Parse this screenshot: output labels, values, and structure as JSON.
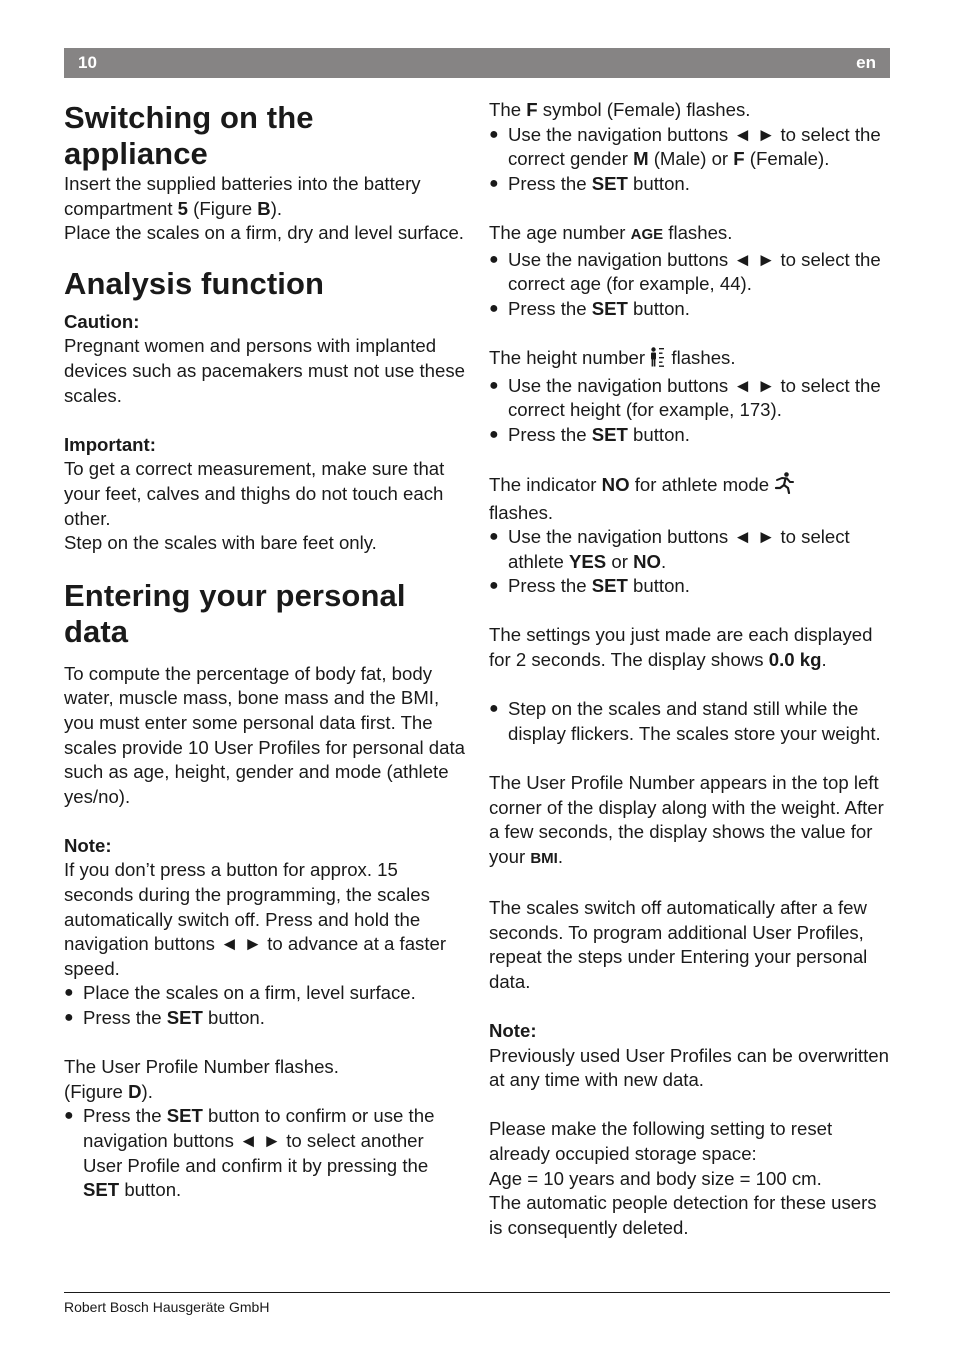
{
  "header": {
    "page_number": "10",
    "language": "en"
  },
  "footer": {
    "company": "Robert Bosch Hausgeräte GmbH"
  },
  "left_column": {
    "switching": {
      "title": "Switching on the appliance",
      "paragraphs": [
        [
          {
            "t": "Insert the supplied batteries into the battery compartment "
          },
          {
            "t": "5",
            "b": true
          },
          {
            "t": " (Figure "
          },
          {
            "t": "B",
            "b": true
          },
          {
            "t": ")."
          }
        ],
        [
          {
            "t": "Place the scales on a firm, dry and level surface."
          }
        ]
      ]
    },
    "analysis": {
      "title": "Analysis function",
      "caution_label": "Caution:",
      "caution_text": "Pregnant women and persons with implanted devices such as pacemakers must not use these scales.",
      "important_label": "Important:",
      "important_text": "To get a correct measurement, make sure that your feet, calves and thighs do not touch each other.",
      "important_text2": "Step on the scales with bare feet only."
    },
    "entering": {
      "title": "Entering your personal data",
      "intro": "To compute the percentage of body fat, body water, muscle mass, bone mass and the BMI, you must enter some personal data first. The scales provide 10 User Profiles for personal data such as age, height, gender and mode (athlete yes/no).",
      "note_label": "Note:",
      "note_text": "If you don’t press a button for approx. 15 seconds during the programming, the scales automatically switch off. Press and hold the navigation buttons ◄ ► to advance at a faster speed.",
      "bullets1": [
        [
          {
            "t": "Place the scales on a firm, level surface."
          }
        ],
        [
          {
            "t": "Press the "
          },
          {
            "t": "SET",
            "b": true
          },
          {
            "t": " button."
          }
        ]
      ],
      "profile_flashes": "The User Profile Number flashes.",
      "figure_ref": [
        {
          "t": "(Figure "
        },
        {
          "t": "D",
          "b": true
        },
        {
          "t": ")."
        }
      ],
      "bullets2": [
        [
          {
            "t": "Press the "
          },
          {
            "t": "SET",
            "b": true
          },
          {
            "t": " button to confirm or use the navigation buttons ◄ ► to select another User Profile and confirm it by pressing the "
          },
          {
            "t": "SET",
            "b": true
          },
          {
            "t": " button."
          }
        ]
      ]
    }
  },
  "right_column": {
    "gender": {
      "intro": [
        {
          "t": "The "
        },
        {
          "t": "F",
          "b": true
        },
        {
          "t": " symbol (Female)  flashes."
        }
      ],
      "bullets": [
        [
          {
            "t": "Use the navigation buttons ◄ ► to select the correct gender "
          },
          {
            "t": "M",
            "b": true
          },
          {
            "t": " (Male) or "
          },
          {
            "t": "F",
            "b": true
          },
          {
            "t": " (Female)."
          }
        ],
        [
          {
            "t": "Press the "
          },
          {
            "t": "SET",
            "b": true
          },
          {
            "t": " button."
          }
        ]
      ]
    },
    "age": {
      "intro": [
        {
          "t": "The age number "
        },
        {
          "t": "AGE",
          "b": true,
          "small": true
        },
        {
          "t": " flashes."
        }
      ],
      "bullets": [
        [
          {
            "t": "Use the navigation buttons ◄ ► to select the correct age (for example, 44)."
          }
        ],
        [
          {
            "t": "Press the "
          },
          {
            "t": "SET",
            "b": true
          },
          {
            "t": " button."
          }
        ]
      ]
    },
    "height": {
      "intro_before": "The height number ",
      "icon": "height-icon",
      "intro_after": " flashes.",
      "bullets": [
        [
          {
            "t": "Use the navigation buttons ◄ ► to select the correct height (for example, 173)."
          }
        ],
        [
          {
            "t": "Press the "
          },
          {
            "t": "SET",
            "b": true
          },
          {
            "t": " button."
          }
        ]
      ]
    },
    "athlete": {
      "intro": [
        {
          "t": "The indicator "
        },
        {
          "t": "NO",
          "b": true
        },
        {
          "t": " for athlete mode "
        }
      ],
      "icon": "athlete-runner-icon",
      "intro_after": "flashes.",
      "bullets": [
        [
          {
            "t": "Use the navigation buttons ◄ ► to select athlete "
          },
          {
            "t": "YES",
            "b": true
          },
          {
            "t": " or "
          },
          {
            "t": "NO",
            "b": true
          },
          {
            "t": "."
          }
        ],
        [
          {
            "t": "Press the "
          },
          {
            "t": "SET",
            "b": true
          },
          {
            "t": " button."
          }
        ]
      ]
    },
    "settings_shown": [
      {
        "t": "The settings you just made are each displayed for 2 seconds. The display shows "
      },
      {
        "t": "0.0 kg",
        "b": true
      },
      {
        "t": "."
      }
    ],
    "step_bullets": [
      [
        {
          "t": "Step on the scales and stand still while the display flickers. The scales store your weight."
        }
      ]
    ],
    "profile_appears": [
      {
        "t": "The User Profile Number appears in the top left corner of the display along with the weight. After a few seconds, the display shows the value for your "
      },
      {
        "t": "BMI",
        "b": true,
        "small": true
      },
      {
        "t": "."
      }
    ],
    "switch_off": "The scales switch off automatically after a few seconds. To program additional User Profiles, repeat the steps under Entering your personal data.",
    "note_label": "Note:",
    "note_text": "Previously used User Profiles can be overwritten at any time with new data.",
    "reset_text": "Please make the following setting to reset already occupied storage space:",
    "reset_values": "Age = 10 years and body size = 100 cm.",
    "reset_consequence": "The automatic people detection for these users is consequently deleted.",
    "bullet_glyph": "●"
  }
}
